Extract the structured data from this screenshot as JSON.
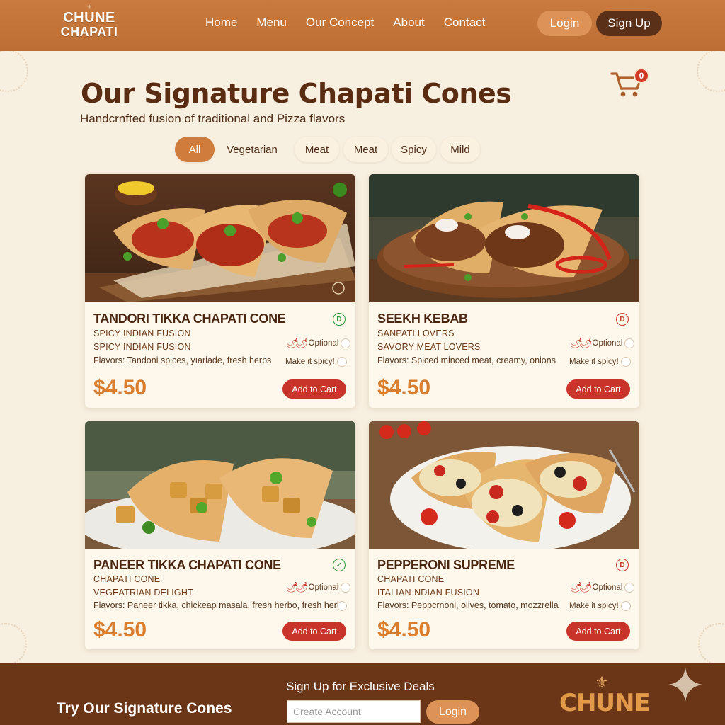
{
  "header": {
    "logo_line1": "CHUNE",
    "logo_line2": "CHAPATI",
    "nav": [
      "Home",
      "Menu",
      "Our Concept",
      "About",
      "Contact"
    ],
    "login_label": "Login",
    "signup_label": "Sign Up"
  },
  "main": {
    "title": "Our Signature Chapati Cones",
    "subtitle": "Handcrnfted fusion of traditional and Pizza flavors",
    "cart_count": "0",
    "filters": [
      "All",
      "Vegetarian",
      "Meat",
      "Meat",
      "Spicy",
      "Mild"
    ],
    "active_filter": "All"
  },
  "products": [
    {
      "name": "TANDORI TIKKA CHAPATI CONE",
      "sub1": "SPICY INDIAN FUSION",
      "sub2": "SPICY INDIAN FUSION",
      "flavors": "Flavors: Tandoni spices, yıariade, fresh herbs",
      "option1": "Optional",
      "option2": "Make it spicy!",
      "price": "$4.50",
      "cta": "Add to Cart",
      "diet": "veg"
    },
    {
      "name": "SEEKH KEBAB",
      "sub1": "SANPATI LOVERS",
      "sub2": "SAVORY MEAT LOVERS",
      "flavors": "Flavors: Spiced minced meat, creamy, onions",
      "option1": "Optional",
      "option2": "Make it spicy!",
      "price": "$4.50",
      "cta": "Add to Cart",
      "diet": "nonveg"
    },
    {
      "name": "PANEER TIKKA CHAPATI CONE",
      "sub1": "CHAPATI CONE",
      "sub2": "VEGEATRIAN DELIGHT",
      "flavors": "Flavors: Paneer tikka, chickeap masala, fresh herbo, fresh herbs",
      "option1": "Optional",
      "option2": "",
      "price": "$4.50",
      "cta": "Add to Cart",
      "diet": "veg"
    },
    {
      "name": "PEPPERONI SUPREME",
      "sub1": "CHAPATI CONE",
      "sub2": "ITALIAN-NDIAN FUSION",
      "flavors": "Flavors: Peppcrnoni, olives, tomato, mozzrella",
      "option1": "Optional",
      "option2": "Make it spicy!",
      "price": "$4.50",
      "cta": "Add to Cart",
      "diet": "nonveg"
    }
  ],
  "footer": {
    "cta": "Try Our Signature Cones",
    "deals": "Sign Up for Exclusive Deals",
    "input_placeholder": "Create Account",
    "login_label": "Login",
    "logo_text": "CHUNE"
  },
  "colors": {
    "header": "#c97a3e",
    "accent": "#cf7c3d",
    "price": "#d97e2e",
    "cart_button": "#c8342a",
    "footer": "#6b3618",
    "background": "#f7efe0"
  },
  "icons": [
    "cart-icon",
    "veg-indicator-icon",
    "nonveg-indicator-icon",
    "chili-icon",
    "sparkle-icon"
  ]
}
